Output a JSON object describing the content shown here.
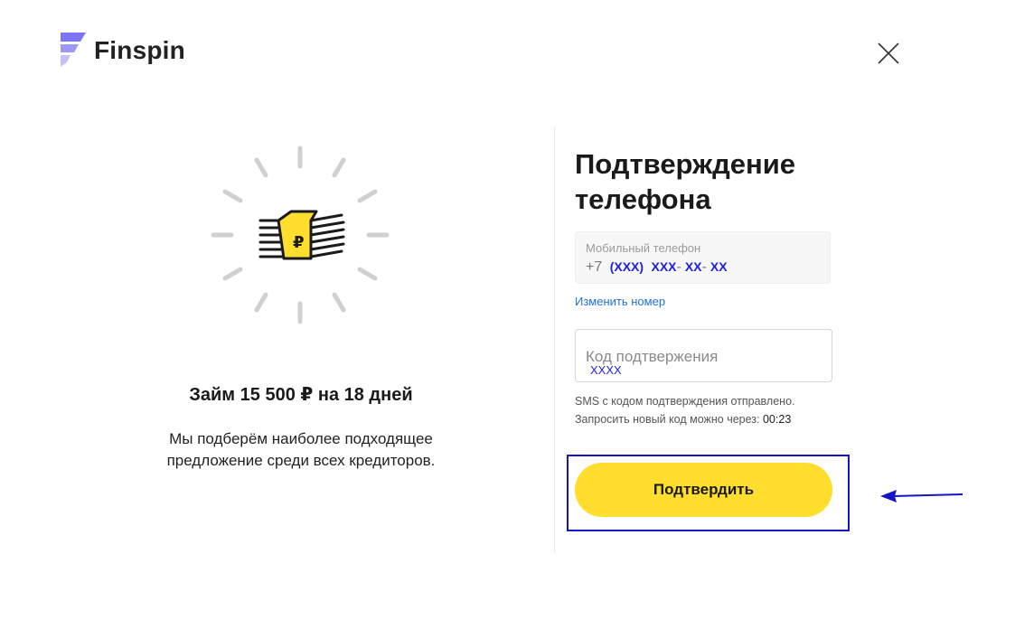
{
  "brand": {
    "name": "Finspin",
    "logo_icon": "finspin-logo-icon",
    "accent_color": "#ffde2e",
    "logo_color": "#7b74f5"
  },
  "header": {
    "close_icon": "close-icon"
  },
  "offer": {
    "title": "Займ 15 500 ₽ на 18 дней",
    "description": "Мы подберём наиболее подходящее предложение среди всех кредиторов.",
    "illustration_icon": "money-stack-ruble-icon"
  },
  "form": {
    "title": "Подтверждение телефона",
    "phone": {
      "label": "Мобильный телефон",
      "prefix": "+7",
      "masked_parts": [
        "(XXX)",
        "XXX",
        "-",
        "XX",
        "-",
        "XX"
      ]
    },
    "change_number_link": "Изменить номер",
    "code": {
      "label": "Код подтвержения",
      "value": "XXXX"
    },
    "sms_sent_text": "SMS с кодом подтверждения отправлено.",
    "resend_text": "Запросить новый код можно через:",
    "timer": "00:23",
    "submit_label": "Подтвердить"
  },
  "annotation": {
    "color": "#1515c8",
    "arrow_icon": "pointer-arrow-icon"
  }
}
